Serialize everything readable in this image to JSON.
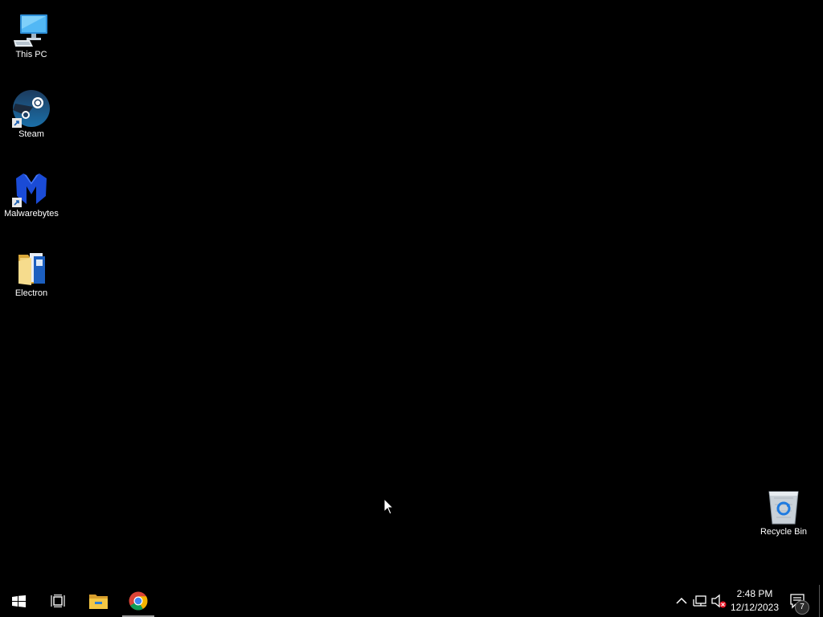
{
  "desktop": {
    "icons": [
      {
        "label": "This PC",
        "icon": "computer-icon"
      },
      {
        "label": "Steam",
        "icon": "steam-icon"
      },
      {
        "label": "Malwarebytes",
        "icon": "malwarebytes-icon"
      },
      {
        "label": "Electron",
        "icon": "folder-icon"
      },
      {
        "label": "Recycle Bin",
        "icon": "recycle-bin-icon"
      }
    ]
  },
  "taskbar": {
    "start": {
      "icon": "windows-start-icon"
    },
    "task_view": {
      "icon": "task-view-icon"
    },
    "pinned": [
      {
        "name": "File Explorer",
        "icon": "file-explorer-icon"
      },
      {
        "name": "Google Chrome",
        "icon": "chrome-icon",
        "active": true
      }
    ],
    "tray": {
      "time": "2:48 PM",
      "date": "12/12/2023",
      "notification_count": "7"
    }
  },
  "colors": {
    "background": "#000000",
    "taskbar": "#000000",
    "text": "#ffffff",
    "active_indicator": "#9a9a9a"
  }
}
